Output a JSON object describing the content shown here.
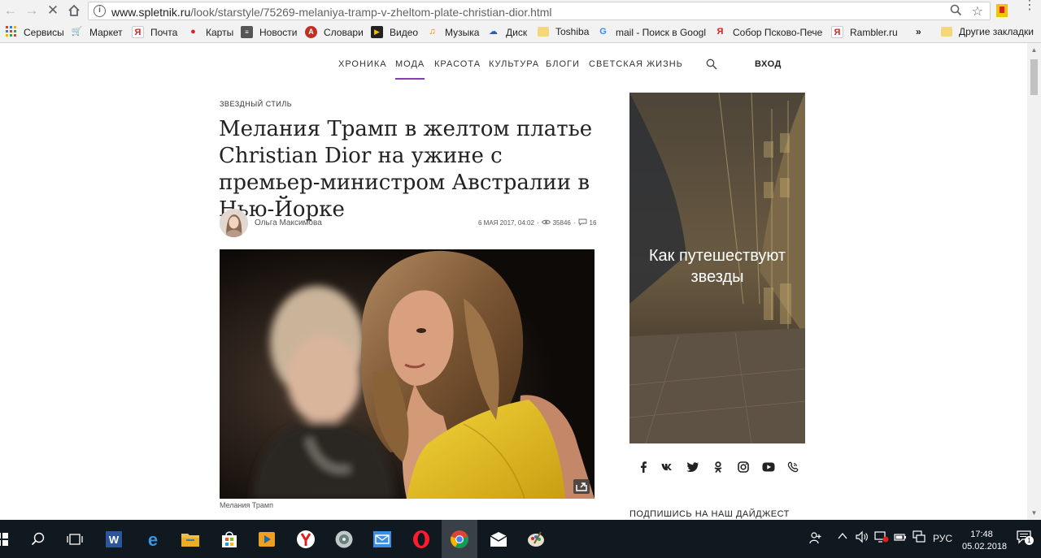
{
  "browser": {
    "url_host": "www.spletnik.ru",
    "url_path": "/look/starstyle/75269-melaniya-tramp-v-zheltom-plate-christian-dior.html",
    "bookmarks": [
      {
        "label": "Сервисы",
        "icon": "apps-icon"
      },
      {
        "label": "Маркет",
        "icon": "cart-icon"
      },
      {
        "label": "Почта",
        "icon": "yandex-icon"
      },
      {
        "label": "Карты",
        "icon": "map-pin-icon"
      },
      {
        "label": "Новости",
        "icon": "news-icon"
      },
      {
        "label": "Словари",
        "icon": "dictionary-icon"
      },
      {
        "label": "Видео",
        "icon": "video-icon"
      },
      {
        "label": "Музыка",
        "icon": "music-icon"
      },
      {
        "label": "Диск",
        "icon": "disk-icon"
      },
      {
        "label": "Toshiba",
        "icon": "folder-icon"
      },
      {
        "label": "mail - Поиск в Googl",
        "icon": "google-icon"
      },
      {
        "label": "Собор Псково-Пече",
        "icon": "yandex-icon"
      },
      {
        "label": "Rambler.ru",
        "icon": "yandex-icon"
      }
    ],
    "bookmarks_overflow": "»",
    "other_bookmarks": "Другие закладки"
  },
  "site": {
    "nav": [
      "ХРОНИКА",
      "МОДА",
      "КРАСОТА",
      "КУЛЬТУРА",
      "БЛОГИ",
      "СВЕТСКАЯ ЖИЗНЬ"
    ],
    "active_nav": "МОДА",
    "login": "ВХОД"
  },
  "article": {
    "rubric": "ЗВЕЗДНЫЙ СТИЛЬ",
    "title": "Мелания Трамп в желтом платье Christian Dior на ужине с премьер-министром Австралии в Нью-Йорке",
    "author": "Ольга Максимова",
    "date": "6 МАЯ 2017, 04:02",
    "views": "35846",
    "comments": "16",
    "caption": "Мелания Трамп"
  },
  "sidebar": {
    "promo_text": "Как путешествуют звезды",
    "socials": [
      "facebook-icon",
      "vk-icon",
      "twitter-icon",
      "odnoklassniki-icon",
      "instagram-icon",
      "youtube-icon",
      "viber-icon"
    ],
    "digest": "ПОДПИШИСЬ НА НАШ ДАЙДЖЕСТ"
  },
  "taskbar": {
    "language": "РУС",
    "time": "17:48",
    "date": "05.02.2018",
    "notifications": "1"
  },
  "colors": {
    "accent": "#8a3db3",
    "taskbar": "#101820",
    "dress": "#e8c11e"
  }
}
